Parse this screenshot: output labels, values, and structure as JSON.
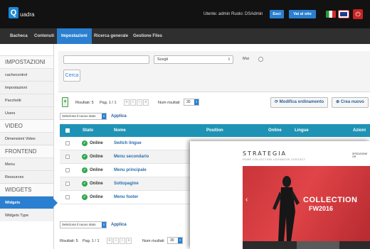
{
  "app": {
    "logo_letter": "Q",
    "logo_text": "uadra"
  },
  "topbar": {
    "user_info": "Utente: admin  Ruolo: DSAdmin",
    "buttons": [
      {
        "label": "Esci"
      },
      {
        "label": "Vai al sito"
      }
    ],
    "power_glyph": "⏻"
  },
  "nav": {
    "tabs": [
      {
        "label": "Bacheca"
      },
      {
        "label": "Contenuti"
      },
      {
        "label": "Impostazioni"
      },
      {
        "label": "Ricerca generale"
      },
      {
        "label": "Gestione Files"
      }
    ],
    "active": "Impostazioni"
  },
  "sidebar": {
    "items": [
      {
        "label": "IMPOSTAZIONI",
        "kind": "section"
      },
      {
        "label": "cachecontrol",
        "kind": "item"
      },
      {
        "label": "Impostazioni",
        "kind": "item"
      },
      {
        "label": "Pacchetti",
        "kind": "item"
      },
      {
        "label": "Users",
        "kind": "item"
      },
      {
        "label": "VIDEO",
        "kind": "section"
      },
      {
        "label": "Dimensioni Video",
        "kind": "item"
      },
      {
        "label": "FRONTEND",
        "kind": "section"
      },
      {
        "label": "Menu",
        "kind": "item"
      },
      {
        "label": "Resources",
        "kind": "item"
      },
      {
        "label": "WIDGETS",
        "kind": "section"
      },
      {
        "label": "Widgets",
        "kind": "item",
        "active": true
      },
      {
        "label": "Widgets Type",
        "kind": "item"
      }
    ]
  },
  "filters": {
    "search_value": "",
    "select_value": "Scegli",
    "select_arrow": "⇕",
    "mai_label": "Mai",
    "cerca_label": "Cerca"
  },
  "toolbar": {
    "doc_glyph": "+",
    "results_text": "Risultati: 5",
    "page_text": "Pag. 1 / 1",
    "pager_glyphs": [
      "«",
      "‹",
      "›",
      "»"
    ],
    "num_results_label": "Num risultati",
    "num_results_value": "30",
    "select_arrow": "⇕",
    "modify_order_label": "Modifica ordinamento",
    "create_new_label": "Crea nuovo",
    "modify_glyph": "⟳",
    "create_glyph": "⊕"
  },
  "status_action": {
    "select_value": "Seleziona il nuovo stato",
    "applica_label": "Applica"
  },
  "table": {
    "headers": [
      "Stato",
      "Nome",
      "Position",
      "Online",
      "Lingue",
      "Azioni"
    ],
    "rows": [
      {
        "stato": "Online",
        "nome": "Switch lingue"
      },
      {
        "stato": "Online",
        "nome": "Menu secondario"
      },
      {
        "stato": "Online",
        "nome": "Menu principale"
      },
      {
        "stato": "Online",
        "nome": "Sottopagine"
      },
      {
        "stato": "Online",
        "nome": "Menu footer"
      }
    ],
    "check_glyph": "✓"
  },
  "overlay": {
    "brand": "STRATEGIA",
    "nav_text": "HOME   COLLECTION   LOOKBOOK   CONTACT",
    "right_text": "SPEDIZIONE GR",
    "collection_text": "COLLECTION",
    "fw_text": "FW2016",
    "arrow": "‹"
  }
}
